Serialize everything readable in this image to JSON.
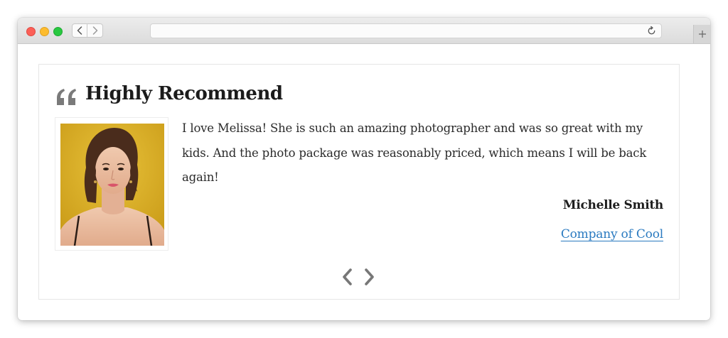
{
  "testimonial": {
    "heading": "Highly Recommend",
    "text": "I love Melissa! She is such an amazing photographer and was so great with my kids. And the photo package was reasonably priced, which means I will be back again!",
    "author": "Michelle Smith",
    "company": "Company of Cool"
  },
  "icons": {
    "quote": "quote-icon",
    "prev": "chevron-left-icon",
    "next": "chevron-right-icon",
    "back": "chevron-left-icon",
    "forward": "chevron-right-icon",
    "reload": "reload-icon",
    "new_tab": "plus-icon"
  },
  "colors": {
    "accent_link": "#2a7ac0",
    "heading_text": "#1b1b1b",
    "icon_gray": "#777777",
    "photo_background": "#dcb427"
  }
}
